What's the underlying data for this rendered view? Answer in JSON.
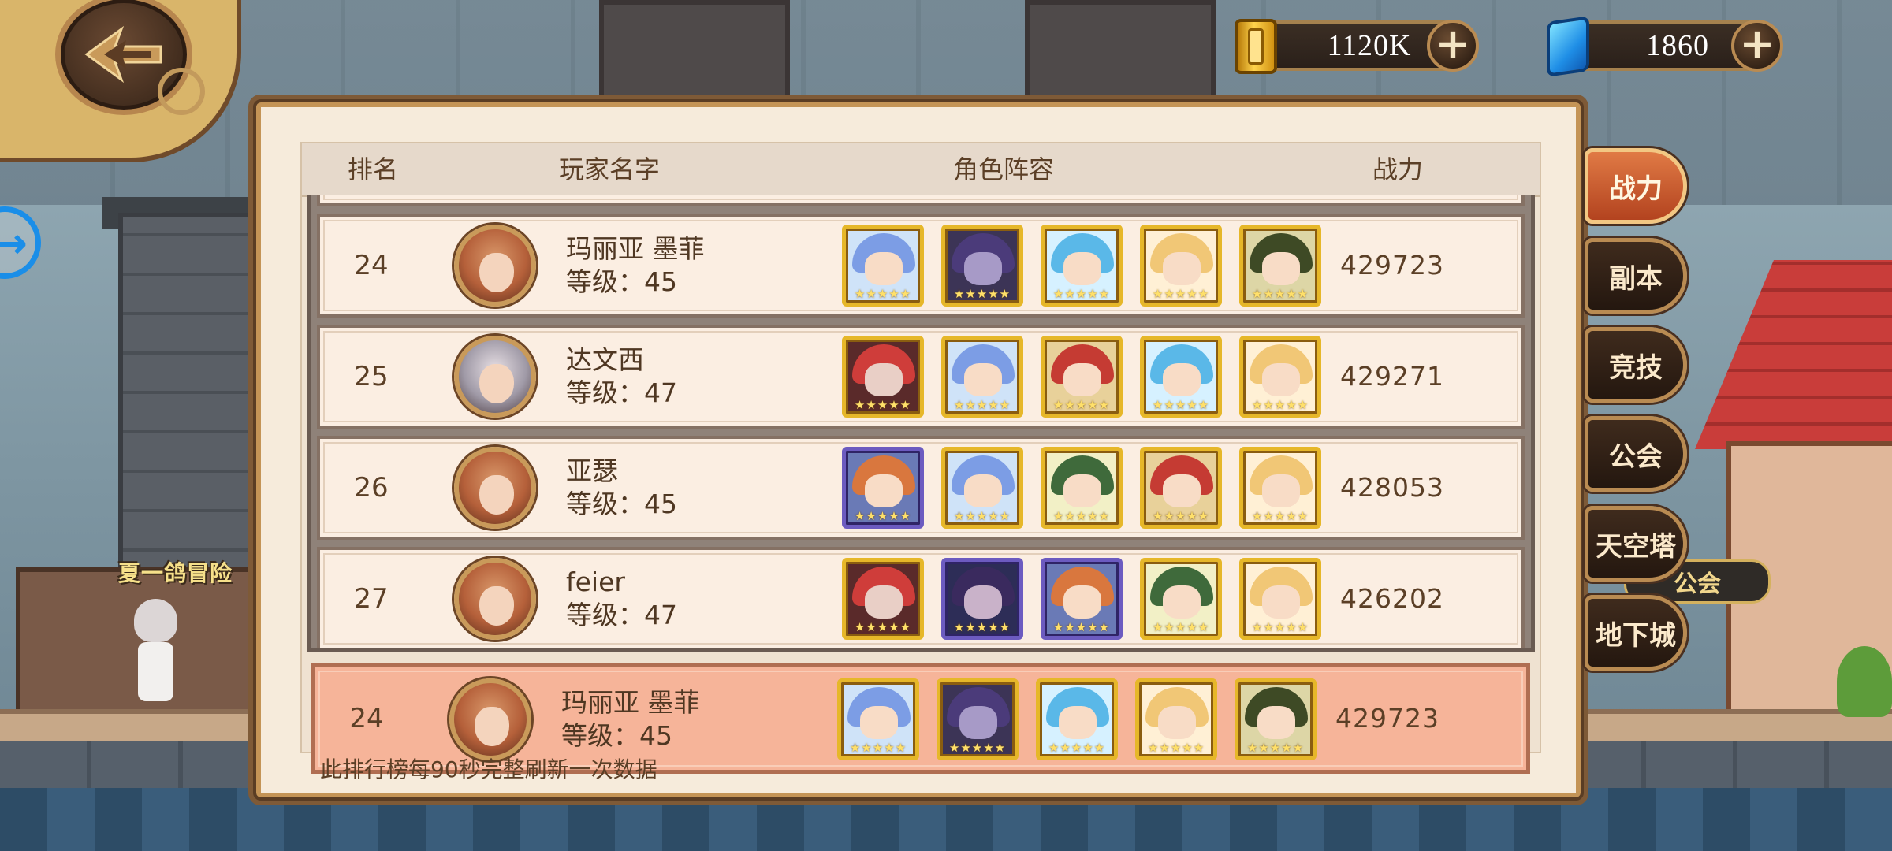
{
  "currency": {
    "gold": {
      "icon": "gold-bar-icon",
      "value": "1120K"
    },
    "gem": {
      "icon": "blue-gem-icon",
      "value": "1860"
    }
  },
  "background": {
    "npc_label": "夏一鸽冒险",
    "sign_text": "公会"
  },
  "table": {
    "headers": {
      "rank": "排名",
      "name": "玩家名字",
      "team": "角色阵容",
      "power": "战力"
    },
    "rows": [
      {
        "rank": "24",
        "name": "玛丽亚 墨菲",
        "level": "等级：45",
        "power": "429723",
        "team": [
          "c-blue gold",
          "c-dark gold",
          "c-cyan gold",
          "c-blond gold",
          "c-green gold"
        ]
      },
      {
        "rank": "25",
        "name": "达文西",
        "level": "等级：47",
        "power": "429271",
        "team": [
          "c-red gold",
          "c-blue gold",
          "c-goggle gold",
          "c-cyan gold",
          "c-blond gold"
        ]
      },
      {
        "rank": "26",
        "name": "亚瑟",
        "level": "等级：45",
        "power": "428053",
        "team": [
          "c-orange purple",
          "c-blue gold",
          "c-hood gold",
          "c-goggle gold",
          "c-blond gold"
        ]
      },
      {
        "rank": "27",
        "name": "feier",
        "level": "等级：47",
        "power": "426202",
        "team": [
          "c-red gold",
          "c-horn purple",
          "c-orange purple",
          "c-hood gold",
          "c-blond gold"
        ]
      }
    ],
    "self_row": {
      "rank": "24",
      "name": "玛丽亚 墨菲",
      "level": "等级：45",
      "power": "429723",
      "team": [
        "c-blue gold",
        "c-dark gold",
        "c-cyan gold",
        "c-blond gold",
        "c-green gold"
      ]
    }
  },
  "footer_note": "此排行榜每90秒完整刷新一次数据",
  "tabs": [
    {
      "label": "战力",
      "active": true
    },
    {
      "label": "副本",
      "active": false
    },
    {
      "label": "竞技",
      "active": false
    },
    {
      "label": "公会",
      "active": false
    },
    {
      "label": "天空塔",
      "active": false
    },
    {
      "label": "地下城",
      "active": false
    }
  ]
}
